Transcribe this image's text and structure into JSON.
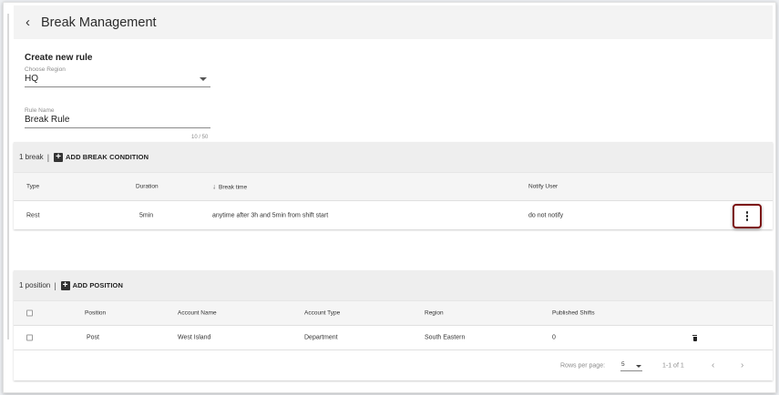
{
  "header": {
    "back_icon": "‹",
    "title": "Break Management"
  },
  "form": {
    "title": "Create new rule",
    "region": {
      "label": "Choose Region",
      "value": "HQ"
    },
    "rule_name": {
      "label": "Rule Name",
      "value": "Break Rule",
      "counter": "10 / 50"
    }
  },
  "breaks": {
    "count_text": "1 break",
    "separator": "|",
    "add_label": "ADD BREAK CONDITION",
    "columns": {
      "type": "Type",
      "duration": "Duration",
      "break_time": "Break time",
      "notify": "Notify User"
    },
    "sort_icon": "↓",
    "rows": [
      {
        "type": "Rest",
        "duration": "5min",
        "break_time": "anytime after 3h and 5min from shift start",
        "notify": "do not notify"
      }
    ]
  },
  "positions": {
    "count_text": "1 position",
    "separator": "|",
    "add_label": "ADD POSITION",
    "columns": {
      "position": "Position",
      "account_name": "Account Name",
      "account_type": "Account Type",
      "region": "Region",
      "published_shifts": "Published Shifts"
    },
    "rows": [
      {
        "position": "Post",
        "account_name": "West Island",
        "account_type": "Department",
        "region": "South Eastern",
        "published_shifts": "0"
      }
    ],
    "pagination": {
      "rows_per_page_label": "Rows per page:",
      "rows_per_page_value": "5",
      "range": "1-1 of 1",
      "prev_icon": "‹",
      "next_icon": "›"
    }
  }
}
